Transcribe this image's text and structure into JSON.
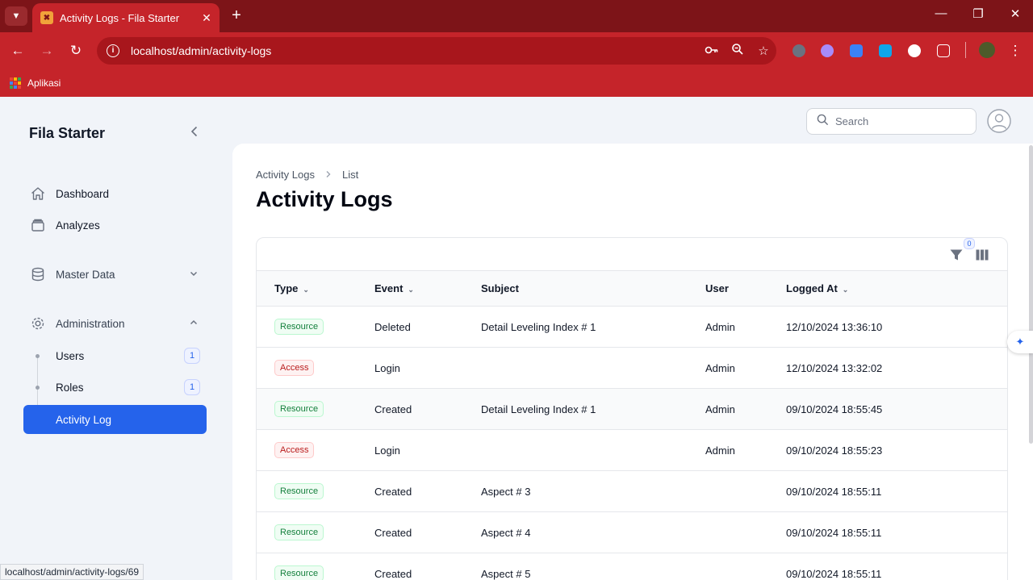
{
  "browser": {
    "tab_title": "Activity Logs - Fila Starter",
    "url": "localhost/admin/activity-logs",
    "bookmark_apps": "Aplikasi",
    "status_url": "localhost/admin/activity-logs/69"
  },
  "app": {
    "brand": "Fila Starter",
    "search_placeholder": "Search"
  },
  "sidebar": {
    "dashboard": "Dashboard",
    "analyzes": "Analyzes",
    "master_data": "Master Data",
    "administration": "Administration",
    "users": {
      "label": "Users",
      "badge": "1"
    },
    "roles": {
      "label": "Roles",
      "badge": "1"
    },
    "activity_log": "Activity Log"
  },
  "page": {
    "breadcrumb_root": "Activity Logs",
    "breadcrumb_current": "List",
    "title": "Activity Logs",
    "filter_count": "0"
  },
  "table": {
    "headers": {
      "type": "Type",
      "event": "Event",
      "subject": "Subject",
      "user": "User",
      "logged_at": "Logged At"
    },
    "rows": [
      {
        "type": "Resource",
        "event": "Deleted",
        "subject": "Detail Leveling Index # 1",
        "user": "Admin",
        "logged_at": "12/10/2024 13:36:10"
      },
      {
        "type": "Access",
        "event": "Login",
        "subject": "",
        "user": "Admin",
        "logged_at": "12/10/2024 13:32:02"
      },
      {
        "type": "Resource",
        "event": "Created",
        "subject": "Detail Leveling Index # 1",
        "user": "Admin",
        "logged_at": "09/10/2024 18:55:45"
      },
      {
        "type": "Access",
        "event": "Login",
        "subject": "",
        "user": "Admin",
        "logged_at": "09/10/2024 18:55:23"
      },
      {
        "type": "Resource",
        "event": "Created",
        "subject": "Aspect # 3",
        "user": "",
        "logged_at": "09/10/2024 18:55:11"
      },
      {
        "type": "Resource",
        "event": "Created",
        "subject": "Aspect # 4",
        "user": "",
        "logged_at": "09/10/2024 18:55:11"
      },
      {
        "type": "Resource",
        "event": "Created",
        "subject": "Aspect # 5",
        "user": "",
        "logged_at": "09/10/2024 18:55:11"
      }
    ]
  },
  "colors": {
    "browser_frame": "#7d1418",
    "browser_toolbar": "#c5242a",
    "primary": "#2563eb",
    "resource_badge": "#15803d",
    "access_badge": "#b91c1c"
  }
}
